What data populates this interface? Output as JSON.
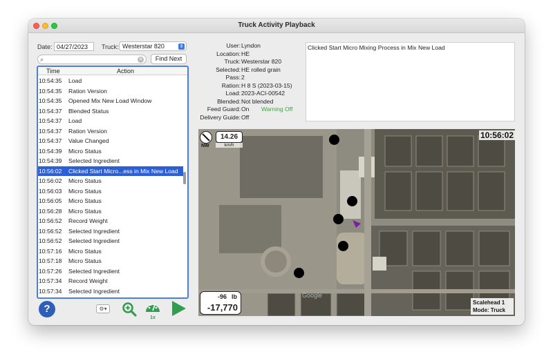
{
  "window": {
    "title": "Truck Activity Playback"
  },
  "filters": {
    "date_label": "Date:",
    "date_value": "04/27/2023",
    "truck_label": "Truck:",
    "truck_value": "Westerstar 820"
  },
  "search": {
    "placeholder": "",
    "find_next_label": "Find Next"
  },
  "table": {
    "columns": [
      "Time",
      "Action"
    ],
    "rows": [
      {
        "time": "10:54:35",
        "action": "Load"
      },
      {
        "time": "10:54:35",
        "action": "Ration Version"
      },
      {
        "time": "10:54:35",
        "action": "Opened Mix New Load Window"
      },
      {
        "time": "10:54:37",
        "action": "Blended Status"
      },
      {
        "time": "10:54:37",
        "action": "Load"
      },
      {
        "time": "10:54:37",
        "action": "Ration Version"
      },
      {
        "time": "10:54:37",
        "action": "Value Changed"
      },
      {
        "time": "10:54:39",
        "action": "Micro Status"
      },
      {
        "time": "10:54:39",
        "action": "Selected Ingredient"
      },
      {
        "time": "10:56:02",
        "action": "Clicked Start Micro...ess in Mix New Load"
      },
      {
        "time": "10:56:02",
        "action": "Micro Status"
      },
      {
        "time": "10:56:03",
        "action": "Micro Status"
      },
      {
        "time": "10:56:05",
        "action": "Micro Status"
      },
      {
        "time": "10:56:28",
        "action": "Micro Status"
      },
      {
        "time": "10:56:52",
        "action": "Record Weight"
      },
      {
        "time": "10:56:52",
        "action": "Selected Ingredient"
      },
      {
        "time": "10:56:52",
        "action": "Selected Ingredient"
      },
      {
        "time": "10:57:16",
        "action": "Micro Status"
      },
      {
        "time": "10:57:18",
        "action": "Micro Status"
      },
      {
        "time": "10:57:26",
        "action": "Selected Ingredient"
      },
      {
        "time": "10:57:34",
        "action": "Record Weight"
      },
      {
        "time": "10:57:34",
        "action": "Selected Ingredient"
      }
    ],
    "selected_index": 9
  },
  "details": {
    "user": {
      "label": "User:",
      "value": "Lyndon"
    },
    "location": {
      "label": "Location:",
      "value": "HE"
    },
    "truck": {
      "label": "Truck:",
      "value": "Westerstar 820"
    },
    "selected": {
      "label": "Selected:",
      "value": "HE rolled grain"
    },
    "pass": {
      "label": "Pass:",
      "value": "2"
    },
    "ration": {
      "label": "Ration:",
      "value": "H 8 S (2023-03-15)"
    },
    "load": {
      "label": "Load:",
      "value": "2023-ACI-00542"
    },
    "blended": {
      "label": "Blended:",
      "value": "Not blended"
    },
    "feed_guard": {
      "label": "Feed Guard:",
      "value": "On",
      "warning": "Warning Off"
    },
    "delivery_guide": {
      "label": "Delivery Guide:",
      "value": "Off"
    }
  },
  "message": "Clicked Start Micro Mixing Process in Mix New Load",
  "map": {
    "heading": "NW",
    "speed": "14.26",
    "speed_unit": "km/h",
    "clock": "10:56:02",
    "weight_delta": "-96",
    "weight_unit": "lb",
    "weight_total": "-17,770",
    "watermark": "Google",
    "scalehead": "Scalehead 1",
    "mode": "Mode: Truck"
  },
  "toolbar": {
    "speed_label": "1x"
  },
  "colors": {
    "accent": "#2a5fd8",
    "warning": "#3aa63a",
    "play": "#2f9e4f"
  }
}
